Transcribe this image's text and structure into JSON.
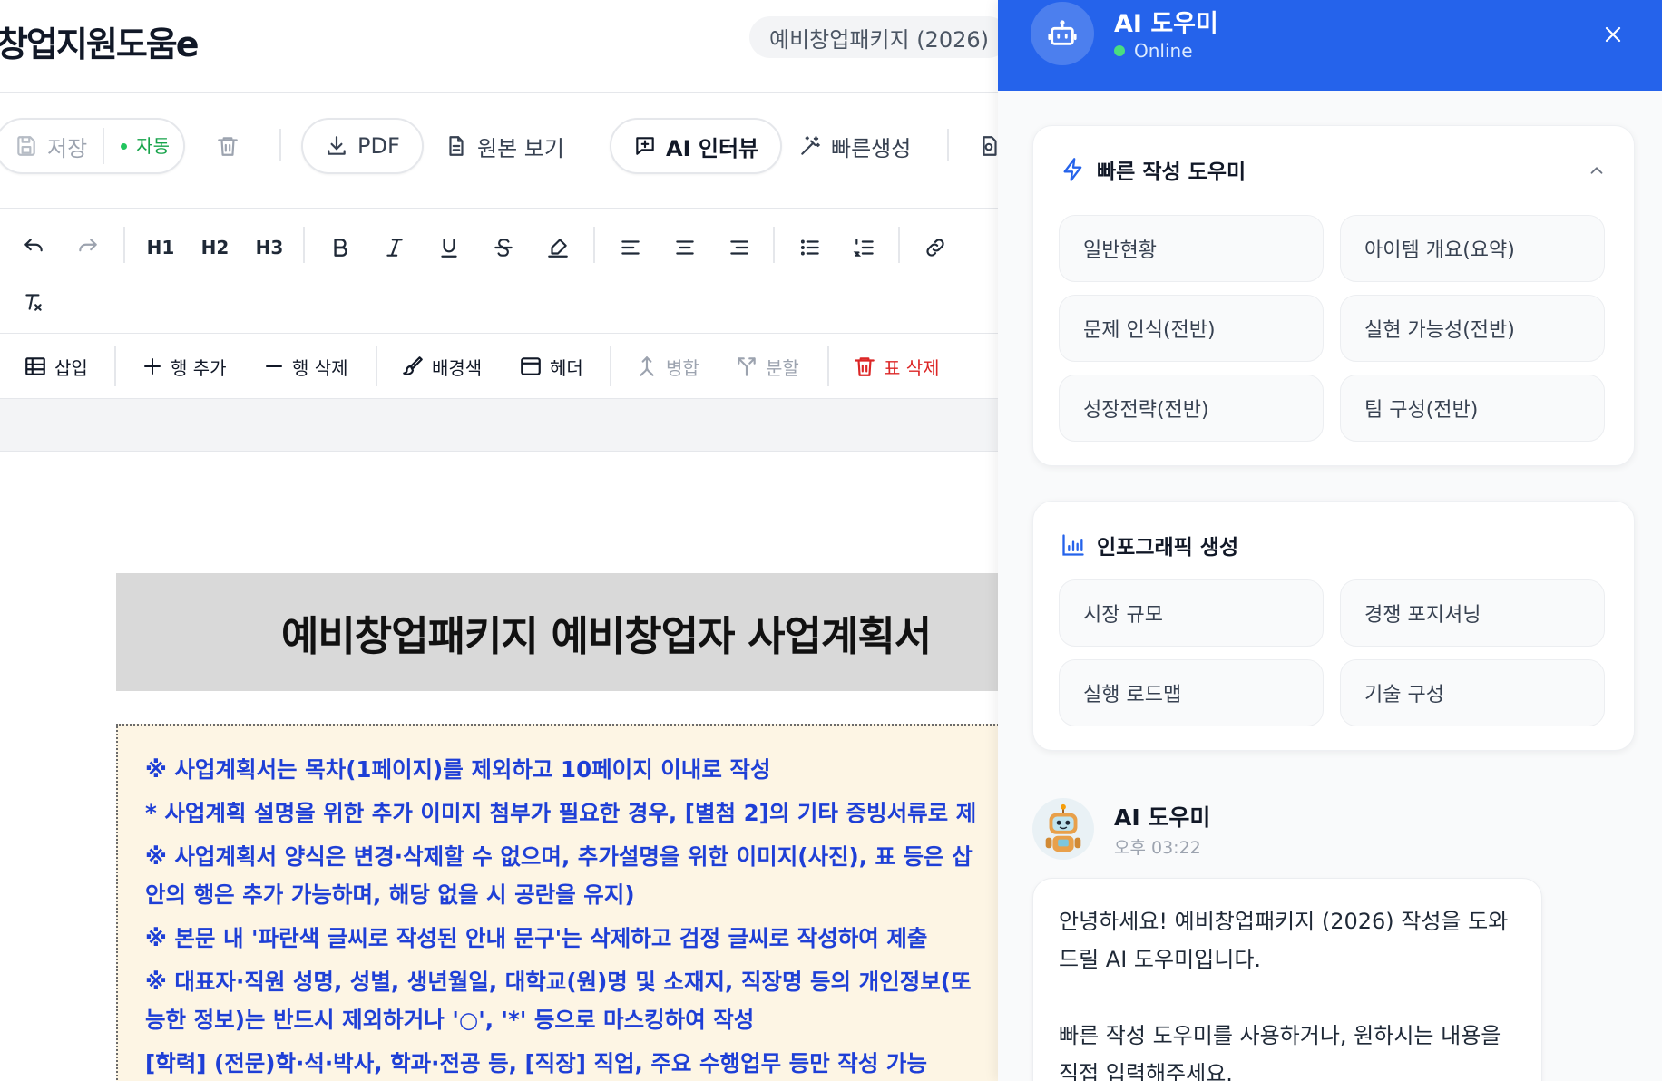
{
  "app": {
    "logo_text": "창업지원도움e",
    "template_badge": "예비창업패키지 (2026)"
  },
  "actions": {
    "save_label": "저장",
    "auto_label": "자동",
    "pdf_label": "PDF",
    "view_original_label": "원본 보기",
    "ai_interview_label": "AI 인터뷰",
    "quick_generate_label": "빠른생성"
  },
  "format_toolbar": {
    "h1": "H1",
    "h2": "H2",
    "h3": "H3"
  },
  "table_toolbar": {
    "insert_label": "삽입",
    "add_row_label": "행 추가",
    "delete_row_label": "행 삭제",
    "bgcolor_label": "배경색",
    "header_label": "헤더",
    "merge_label": "병합",
    "split_label": "분할",
    "delete_table_label": "표 삭제"
  },
  "document": {
    "title": "예비창업패키지 예비창업자 사업계획서",
    "notice_lines": [
      "※ 사업계획서는 목차(1페이지)를 제외하고 10페이지 이내로 작성",
      " * 사업계획 설명을 위한 추가 이미지 첨부가 필요한 경우, [별첨 2]의 기타 증빙서류로 제",
      "※ 사업계획서 양식은 변경·삭제할 수 없으며, 추가설명을 위한 이미지(사진), 표 등은 삽",
      "안의 행은 추가 가능하며, 해당 없을 시 공란을 유지)",
      "※ 본문 내 '파란색 글씨로 작성된 안내 문구'는 삭제하고 검정 글씨로 작성하여 제출",
      "※ 대표자·직원 성명, 성별, 생년월일, 대학교(원)명 및 소재지, 직장명 등의 개인정보(또",
      "능한 정보)는 반드시 제외하거나 '○', '*' 등으로 마스킹하여 작성",
      "  [학력] (전문)학·석·박사, 학과·전공 등, [직장] 직업, 주요 수행업무 등만 작성 가능"
    ]
  },
  "ai_panel": {
    "title": "AI 도우미",
    "status": "Online",
    "quick_section": {
      "title": "빠른 작성 도우미",
      "chips": [
        "일반현황",
        "아이템 개요(요약)",
        "문제 인식(전반)",
        "실현 가능성(전반)",
        "성장전략(전반)",
        "팀 구성(전반)"
      ]
    },
    "infographic_section": {
      "title": "인포그래픽 생성",
      "chips": [
        "시장 규모",
        "경쟁 포지셔닝",
        "실행 로드맵",
        "기술 구성"
      ]
    },
    "message": {
      "sender": "AI 도우미",
      "time": "오후 03:22",
      "paragraph1": "안녕하세요! 예비창업패키지 (2026) 작성을 도와드릴 AI 도우미입니다.",
      "paragraph2": "빠른 작성 도우미를 사용하거나, 원하시는 내용을 직접 입력해주세요."
    }
  },
  "colors": {
    "accent": "#2563eb",
    "notice_text": "#1e3fd6",
    "notice_bg": "#fdf5e4",
    "danger": "#dc2626",
    "online": "#4ade80"
  }
}
